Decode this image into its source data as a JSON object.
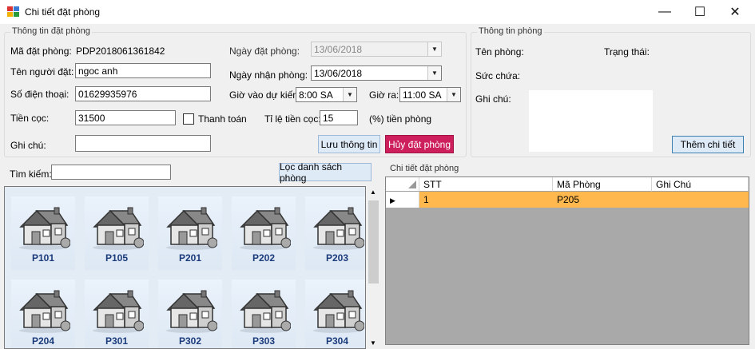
{
  "window": {
    "title": "Chi tiết đặt phòng",
    "minimize": "—",
    "maximize": "☐",
    "close": "✕"
  },
  "booking": {
    "legend": "Thông tin đặt phòng",
    "code_label": "Mã đặt phòng:",
    "code_value": "PDP2018061361842",
    "name_label": "Tên người đặt:",
    "name_value": "ngoc anh",
    "phone_label": "Số điện thoại:",
    "phone_value": "01629935976",
    "deposit_label": "Tiền cọc:",
    "deposit_value": "31500",
    "paid_label": "Thanh toán",
    "note_label": "Ghi chú:",
    "note_value": "",
    "booking_date_label": "Ngày đặt phòng:",
    "booking_date_value": "13/06/2018",
    "checkin_date_label": "Ngày nhận phòng:",
    "checkin_date_value": "13/06/2018",
    "checkin_time_label": "Giờ vào dự kiến:",
    "checkin_time_value": "8:00 SA",
    "checkout_time_label": "Giờ ra:",
    "checkout_time_value": "11:00 SA",
    "deposit_rate_label": "Tỉ lệ tiền cọc:",
    "deposit_rate_value": "15",
    "deposit_rate_suffix": "(%) tiền phòng",
    "save_button": "Lưu thông tin",
    "cancel_button": "Hủy đặt phòng"
  },
  "room_info": {
    "legend": "Thông tin phòng",
    "room_name_label": "Tên phòng:",
    "status_label": "Trạng thái:",
    "capacity_label": "Sức chứa:",
    "note_label": "Ghi chú:",
    "add_detail_button": "Thêm chi tiết"
  },
  "search": {
    "label": "Tìm kiếm:",
    "value": "",
    "filter_button": "Lọc danh sách phòng"
  },
  "rooms": [
    "P101",
    "P105",
    "P201",
    "P202",
    "P203",
    "P204",
    "P301",
    "P302",
    "P303",
    "P304"
  ],
  "details": {
    "legend": "Chi tiết đặt phòng",
    "columns": [
      "STT",
      "Mã Phòng",
      "Ghi Chú"
    ],
    "rows": [
      {
        "stt": "1",
        "room": "P205",
        "note": ""
      }
    ]
  }
}
